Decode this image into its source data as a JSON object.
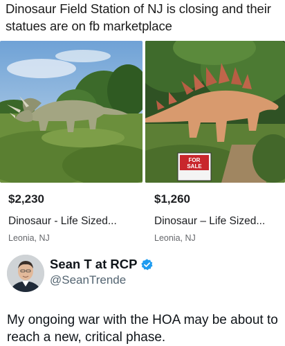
{
  "headline": "Dinosaur Field Station of NJ is closing and their statues are on fb marketplace",
  "listings": [
    {
      "price": "$2,230",
      "title": "Dinosaur - Life Sized...",
      "location": "Leonia, NJ",
      "image_icon": "triceratops-statue-photo"
    },
    {
      "price": "$1,260",
      "title": "Dinosaur – Life Sized...",
      "location": "Leonia, NJ",
      "image_icon": "stegosaurus-statue-photo",
      "sign_line1": "FOR",
      "sign_line2": "SALE"
    }
  ],
  "tweet": {
    "name": "Sean T at RCP",
    "handle": "@SeanTrende",
    "text": "My ongoing war with the HOA may be about to reach a new, critical phase.",
    "verified_color": "#1d9bf0"
  }
}
